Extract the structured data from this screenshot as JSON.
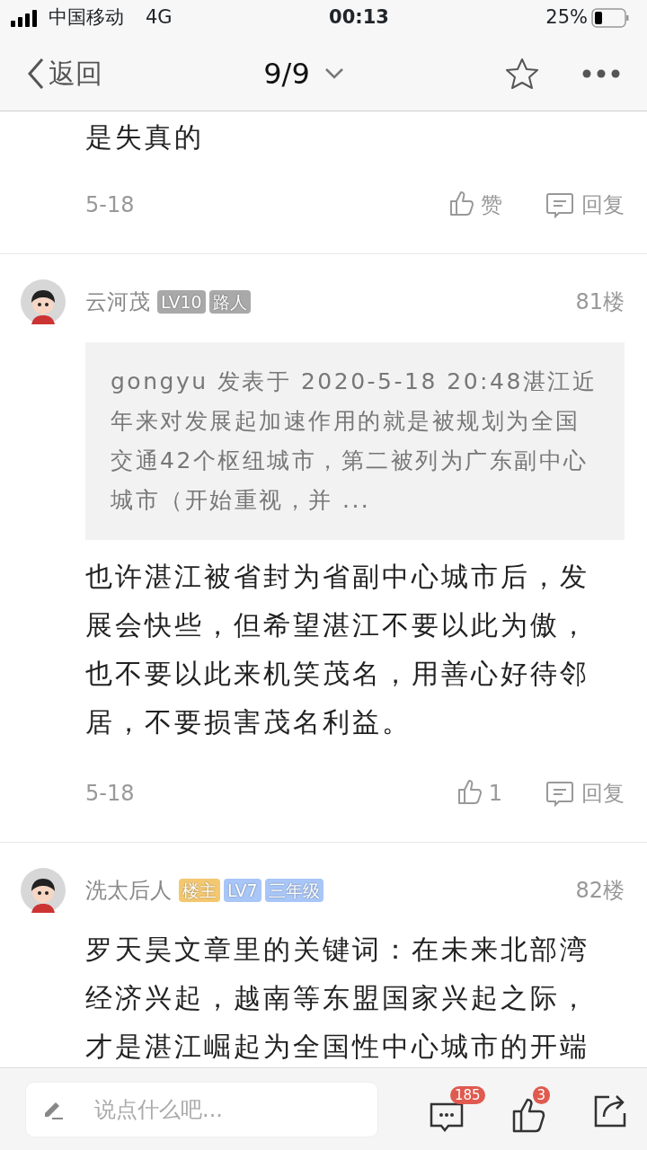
{
  "status_bar": {
    "carrier": "中国移动",
    "network": "4G",
    "time": "00:13",
    "battery": "25%"
  },
  "nav": {
    "back": "返回",
    "title": "9/9"
  },
  "posts": [
    {
      "kind": "tail",
      "text": "是失真的",
      "date": "5-18",
      "like": "赞",
      "reply": "回复"
    },
    {
      "kind": "full",
      "author": "云河茂",
      "badges": [
        {
          "text": "LV10",
          "color": "#a9a9a9"
        },
        {
          "text": "路人",
          "color": "#a9a9a9"
        }
      ],
      "floor": "81楼",
      "quote": "gongyu 发表于 2020-5-18 20:48湛江近年来对发展起加速作用的就是被规划为全国交通42个枢纽城市，第二被列为广东副中心城市（开始重视，并 ...",
      "text": "也许湛江被省封为省副中心城市后，发展会快些，但希望湛江不要以此为傲，也不要以此来机笑茂名，用善心好待邻居，不要损害茂名利益。",
      "date": "5-18",
      "like": "1",
      "reply": "回复"
    },
    {
      "kind": "cut",
      "author": "洗太后人",
      "badges": [
        {
          "text": "楼主",
          "color": "#f3c870"
        },
        {
          "text": "LV7",
          "color": "#a8c6f7"
        },
        {
          "text": "三年级",
          "color": "#a8c6f7"
        }
      ],
      "floor": "82楼",
      "text": "罗天昊文章里的关键词：在未来北部湾经济兴起，越南等东盟国家兴起之际，才是湛江崛起为全国性中心城市的开端"
    }
  ],
  "bottom_bar": {
    "placeholder": "说点什么吧...",
    "comment_count": "185",
    "like_count": "3"
  }
}
